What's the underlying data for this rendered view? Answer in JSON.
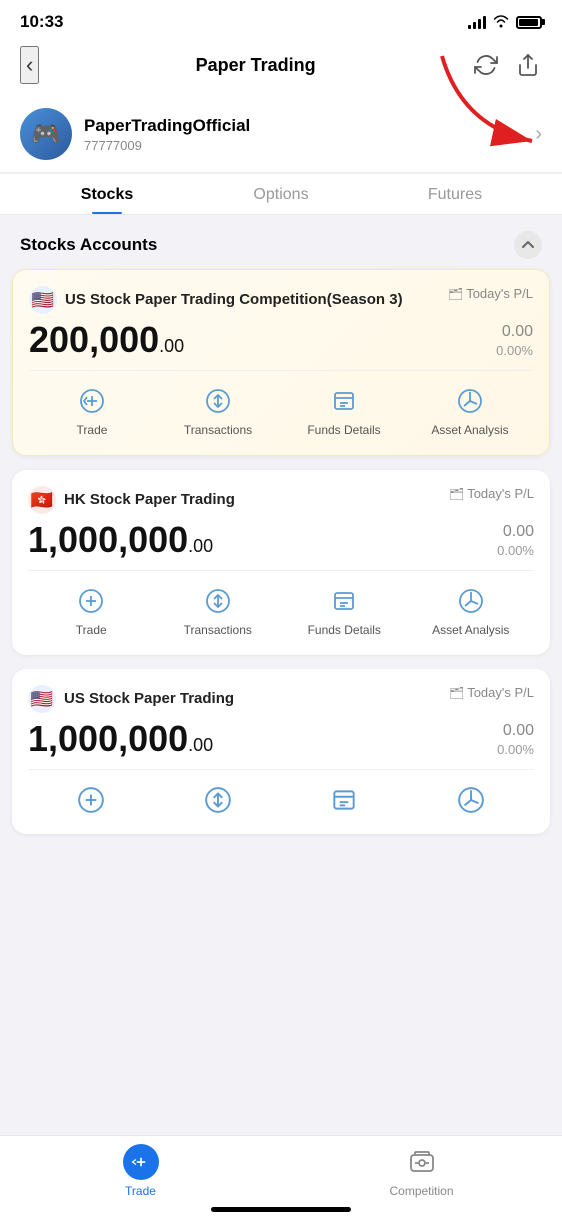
{
  "statusBar": {
    "time": "10:33"
  },
  "header": {
    "title": "Paper Trading",
    "backLabel": "‹"
  },
  "profile": {
    "name": "PaperTradingOfficial",
    "id": "77777009",
    "emoji": "🎮"
  },
  "tabs": [
    {
      "label": "Stocks",
      "active": true
    },
    {
      "label": "Options",
      "active": false
    },
    {
      "label": "Futures",
      "active": false
    }
  ],
  "stocksSection": {
    "title": "Stocks Accounts"
  },
  "accounts": [
    {
      "id": "us-competition",
      "flag": "🇺🇸",
      "flagType": "us",
      "title": "US Stock Paper Trading Competition(Season 3)",
      "plLabel": "Today's P/L",
      "balance": "200,000",
      "decimals": ".00",
      "plValue": "0.00",
      "plPct": "0.00%",
      "isCompetition": true,
      "actions": [
        "Trade",
        "Transactions",
        "Funds Details",
        "Asset Analysis"
      ]
    },
    {
      "id": "hk-stock",
      "flag": "🇭🇰",
      "flagType": "hk",
      "title": "HK Stock Paper Trading",
      "plLabel": "Today's P/L",
      "balance": "1,000,000",
      "decimals": ".00",
      "plValue": "0.00",
      "plPct": "0.00%",
      "isCompetition": false,
      "actions": [
        "Trade",
        "Transactions",
        "Funds Details",
        "Asset Analysis"
      ]
    },
    {
      "id": "us-stock",
      "flag": "🇺🇸",
      "flagType": "us",
      "title": "US Stock Paper Trading",
      "plLabel": "Today's P/L",
      "balance": "1,000,000",
      "decimals": ".00",
      "plValue": "0.00",
      "plPct": "0.00%",
      "isCompetition": false,
      "actions": [
        "Trade",
        "Transactions",
        "Funds Details",
        "Asset Analysis"
      ]
    }
  ],
  "bottomNav": [
    {
      "label": "Trade",
      "active": true
    },
    {
      "label": "Competition",
      "active": false
    }
  ]
}
